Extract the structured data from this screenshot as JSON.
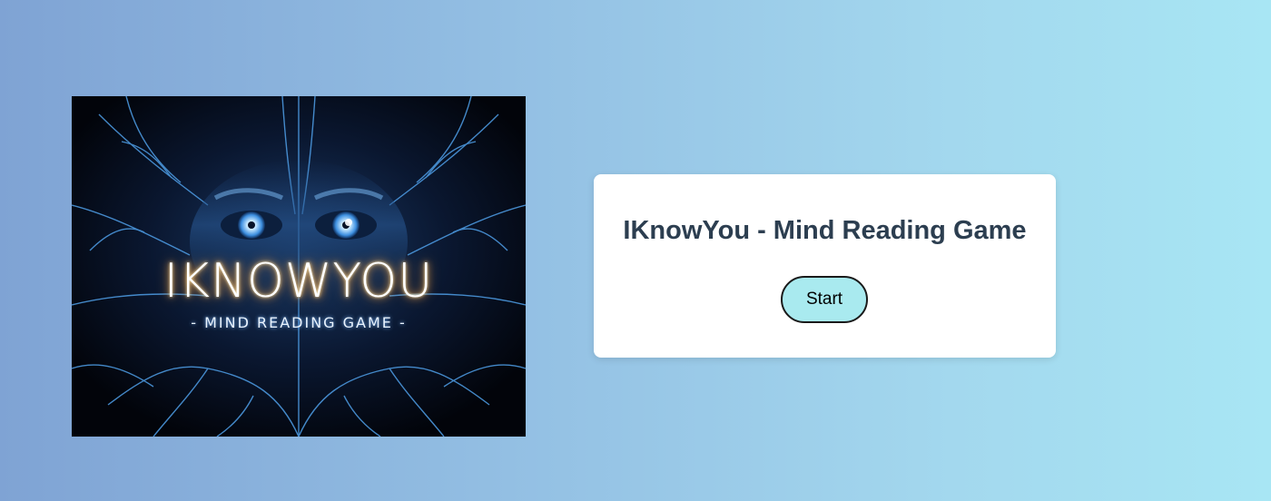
{
  "hero": {
    "logo_title": "IKNOWYOU",
    "logo_subtitle": "- MIND READING GAME -"
  },
  "card": {
    "title": "IKnowYou - Mind Reading Game",
    "start_label": "Start"
  },
  "colors": {
    "card_title": "#2c3e50",
    "button_bg": "#a9eaef",
    "glow": "#f2a64a"
  }
}
